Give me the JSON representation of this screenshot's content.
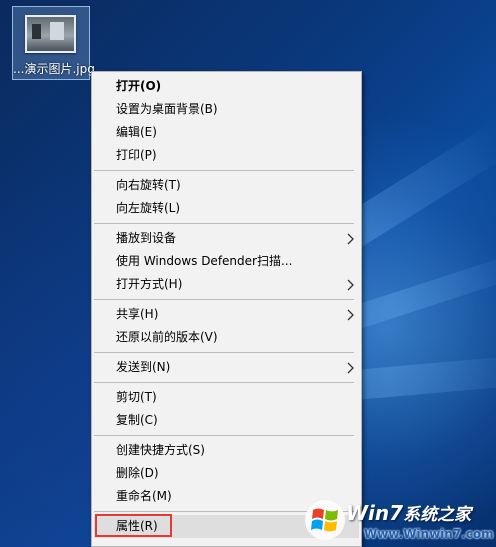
{
  "desktop_file": {
    "label": "...演示图片.jpg"
  },
  "context_menu": {
    "groups": [
      [
        {
          "label": "打开(O)",
          "bold": true
        },
        {
          "label": "设置为桌面背景(B)"
        },
        {
          "label": "编辑(E)"
        },
        {
          "label": "打印(P)"
        }
      ],
      [
        {
          "label": "向右旋转(T)"
        },
        {
          "label": "向左旋转(L)"
        }
      ],
      [
        {
          "label": "播放到设备",
          "submenu": true
        },
        {
          "label": "使用 Windows Defender扫描..."
        },
        {
          "label": "打开方式(H)",
          "submenu": true
        }
      ],
      [
        {
          "label": "共享(H)",
          "submenu": true
        },
        {
          "label": "还原以前的版本(V)"
        }
      ],
      [
        {
          "label": "发送到(N)",
          "submenu": true
        }
      ],
      [
        {
          "label": "剪切(T)"
        },
        {
          "label": "复制(C)"
        }
      ],
      [
        {
          "label": "创建快捷方式(S)"
        },
        {
          "label": "删除(D)"
        },
        {
          "label": "重命名(M)"
        }
      ],
      [
        {
          "label": "属性(R)",
          "highlighted": true
        }
      ]
    ]
  },
  "watermark": {
    "brand_main": "Win7",
    "brand_sub": "系统之家",
    "url": "Www.Winwin7.com"
  },
  "colors": {
    "menu_background": "#f2f2f2",
    "highlight_box": "#e53935",
    "desktop_blue": "#0a3a80"
  }
}
